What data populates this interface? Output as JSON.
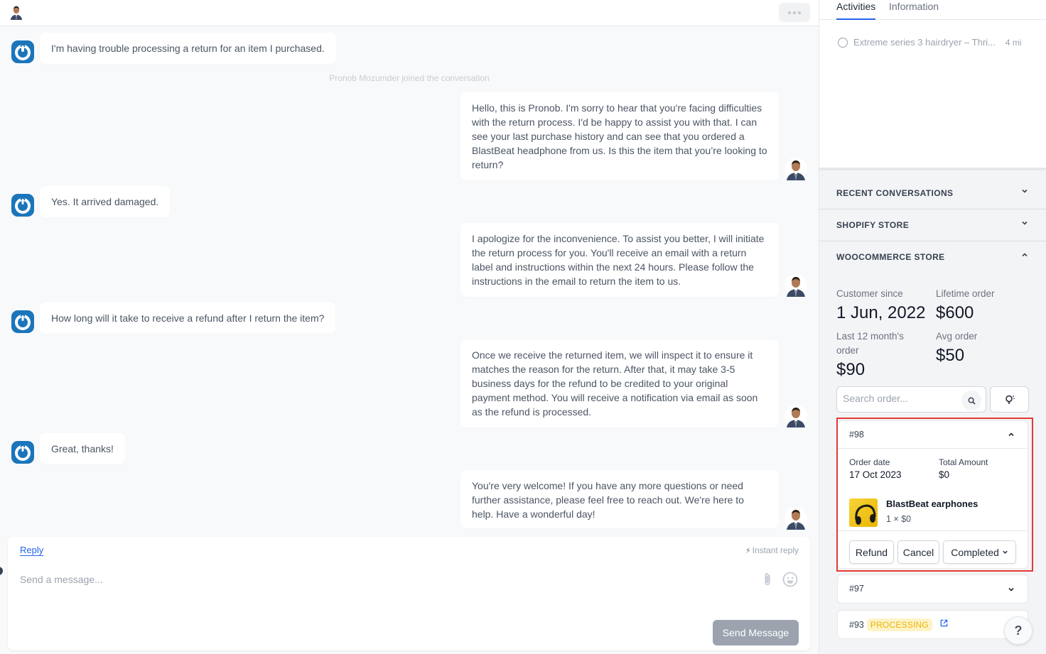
{
  "header": {
    "more_label": "more options"
  },
  "conversation": {
    "system_note": "Pronob Mozumder joined the conversation",
    "messages": [
      {
        "sender": "customer",
        "text": "I'm having trouble processing a return for an item I purchased."
      },
      {
        "sender": "agent",
        "text": "Hello, this is Pronob. I'm sorry to hear that you're facing difficulties with the return process. I'd be happy to assist you with that. I can see your last purchase history and can see that you ordered a BlastBeat headphone from us. Is this the item that you’re looking to return?"
      },
      {
        "sender": "customer",
        "text": "Yes. It arrived damaged."
      },
      {
        "sender": "agent",
        "text": "I apologize for the inconvenience. To assist you better, I will initiate the return process for you. You'll receive an email with a return label and instructions within the next 24 hours. Please follow the instructions in the email to return the item to us."
      },
      {
        "sender": "customer",
        "text": "How long will it take to receive a refund after I return the item?"
      },
      {
        "sender": "agent",
        "text": "Once we receive the returned item, we will inspect it to ensure it matches the reason for the return. After that, it may take 3-5 business days for the refund to be credited to your original payment method. You will receive a notification via email as soon as the refund is processed."
      },
      {
        "sender": "customer",
        "text": "Great, thanks!"
      },
      {
        "sender": "agent",
        "text": "You're very welcome! If you have any more questions or need further assistance, please feel free to reach out. We're here to help. Have a wonderful day!"
      }
    ]
  },
  "composer": {
    "reply_tab": "Reply",
    "instant_reply": "Instant reply",
    "placeholder": "Send a message...",
    "value": "",
    "send_label": "Send Message"
  },
  "sidebar": {
    "tabs": [
      {
        "label": "Activities",
        "active": true
      },
      {
        "label": "Information",
        "active": false
      }
    ],
    "activities": [
      {
        "text": "Extreme series 3 hairdryer – Thri...",
        "time": "4 mi"
      }
    ],
    "sections": [
      {
        "label": "RECENT CONVERSATIONS",
        "expanded": false
      },
      {
        "label": "SHOPIFY STORE",
        "expanded": false
      },
      {
        "label": "WOOCOMMERCE STORE",
        "expanded": true
      }
    ],
    "woocommerce": {
      "customer_since_label": "Customer since",
      "customer_since": "1 Jun, 2022",
      "lifetime_order_label": "Lifetime order",
      "lifetime_order": "$600",
      "last12_label": "Last 12 month's order",
      "last12": "$90",
      "avg_order_label": "Avg order",
      "avg_order": "$50",
      "search_placeholder": "Search order...",
      "search_value": "",
      "orders": [
        {
          "id": "#98",
          "expanded": true,
          "order_date_label": "Order date",
          "order_date": "17 Oct 2023",
          "total_label": "Total Amount",
          "total": "$0",
          "product_name": "BlastBeat earphones",
          "product_qty": "1 × $0",
          "actions": {
            "refund": "Refund",
            "cancel": "Cancel",
            "status": "Completed"
          }
        },
        {
          "id": "#97",
          "expanded": false
        },
        {
          "id": "#93",
          "status_badge": "PROCESSING"
        }
      ]
    },
    "help_label": "?"
  },
  "colors": {
    "accent": "#2563eb",
    "highlight_border": "#e53935",
    "badge_bg": "#fef3c7",
    "badge_text": "#eab308",
    "customer_avatar": "#1b75bb",
    "send_disabled": "#9ca3af"
  }
}
